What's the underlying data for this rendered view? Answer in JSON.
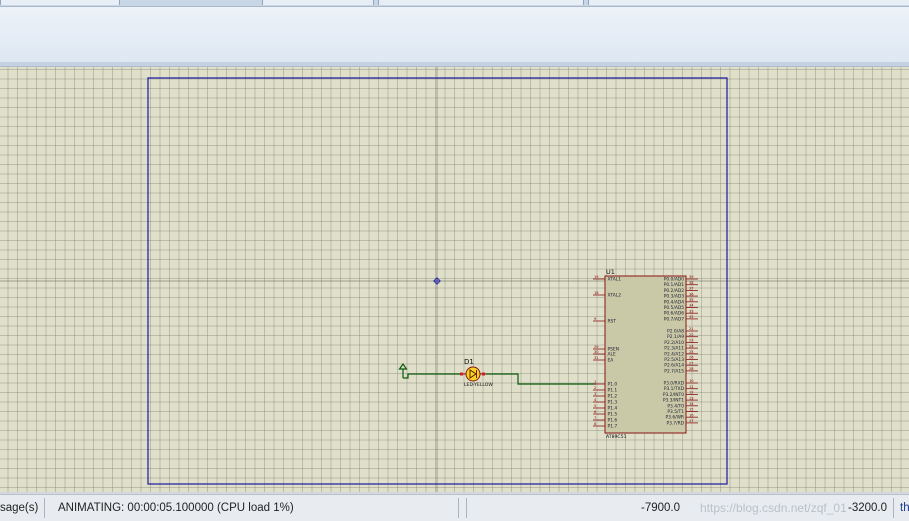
{
  "statusbar": {
    "messages": "sage(s)",
    "animation": "ANIMATING: 00:00:05.100000 (CPU load 1%)",
    "coord_x": "-7900.0",
    "coord_y": "-3200.0",
    "unit": "th",
    "watermark": "https://blog.csdn.net/zqf_01"
  },
  "schematic": {
    "chip_ref": "U1",
    "chip_part": "AT89C51",
    "led_ref": "D1",
    "led_part": "LED-YELLOW",
    "left_pins": [
      {
        "num": "19",
        "name": "XTAL1"
      },
      {
        "num": "18",
        "name": "XTAL2"
      },
      {
        "num": "9",
        "name": "RST"
      },
      {
        "num": "29",
        "name": "PSEN"
      },
      {
        "num": "30",
        "name": "ALE"
      },
      {
        "num": "31",
        "name": "EA"
      },
      {
        "num": "1",
        "name": "P1.0"
      },
      {
        "num": "2",
        "name": "P1.1"
      },
      {
        "num": "3",
        "name": "P1.2"
      },
      {
        "num": "4",
        "name": "P1.3"
      },
      {
        "num": "5",
        "name": "P1.4"
      },
      {
        "num": "6",
        "name": "P1.5"
      },
      {
        "num": "7",
        "name": "P1.6"
      },
      {
        "num": "8",
        "name": "P1.7"
      }
    ],
    "right_pins": [
      {
        "num": "39",
        "name": "P0.0/AD0"
      },
      {
        "num": "38",
        "name": "P0.1/AD1"
      },
      {
        "num": "37",
        "name": "P0.2/AD2"
      },
      {
        "num": "36",
        "name": "P0.3/AD3"
      },
      {
        "num": "35",
        "name": "P0.4/AD4"
      },
      {
        "num": "34",
        "name": "P0.5/AD5"
      },
      {
        "num": "33",
        "name": "P0.6/AD6"
      },
      {
        "num": "32",
        "name": "P0.7/AD7"
      },
      {
        "num": "21",
        "name": "P2.0/A8"
      },
      {
        "num": "22",
        "name": "P2.1/A9"
      },
      {
        "num": "23",
        "name": "P2.2/A10"
      },
      {
        "num": "24",
        "name": "P2.3/A11"
      },
      {
        "num": "25",
        "name": "P2.4/A12"
      },
      {
        "num": "26",
        "name": "P2.5/A13"
      },
      {
        "num": "27",
        "name": "P2.6/A14"
      },
      {
        "num": "28",
        "name": "P2.7/A15"
      },
      {
        "num": "10",
        "name": "P3.0/RXD"
      },
      {
        "num": "11",
        "name": "P3.1/TXD"
      },
      {
        "num": "12",
        "name": "P3.2/INT0"
      },
      {
        "num": "13",
        "name": "P3.3/INT1"
      },
      {
        "num": "14",
        "name": "P3.4/T0"
      },
      {
        "num": "15",
        "name": "P3.5/T1"
      },
      {
        "num": "16",
        "name": "P3.6/WR"
      },
      {
        "num": "17",
        "name": "P3.7/RD"
      }
    ]
  },
  "colors": {
    "sheet_border": "#1a1aa0",
    "wire": "#0a5a0a",
    "chip_fill": "#c9c9a8",
    "chip_border": "#8a1515",
    "led_fill": "#f7d21e"
  }
}
